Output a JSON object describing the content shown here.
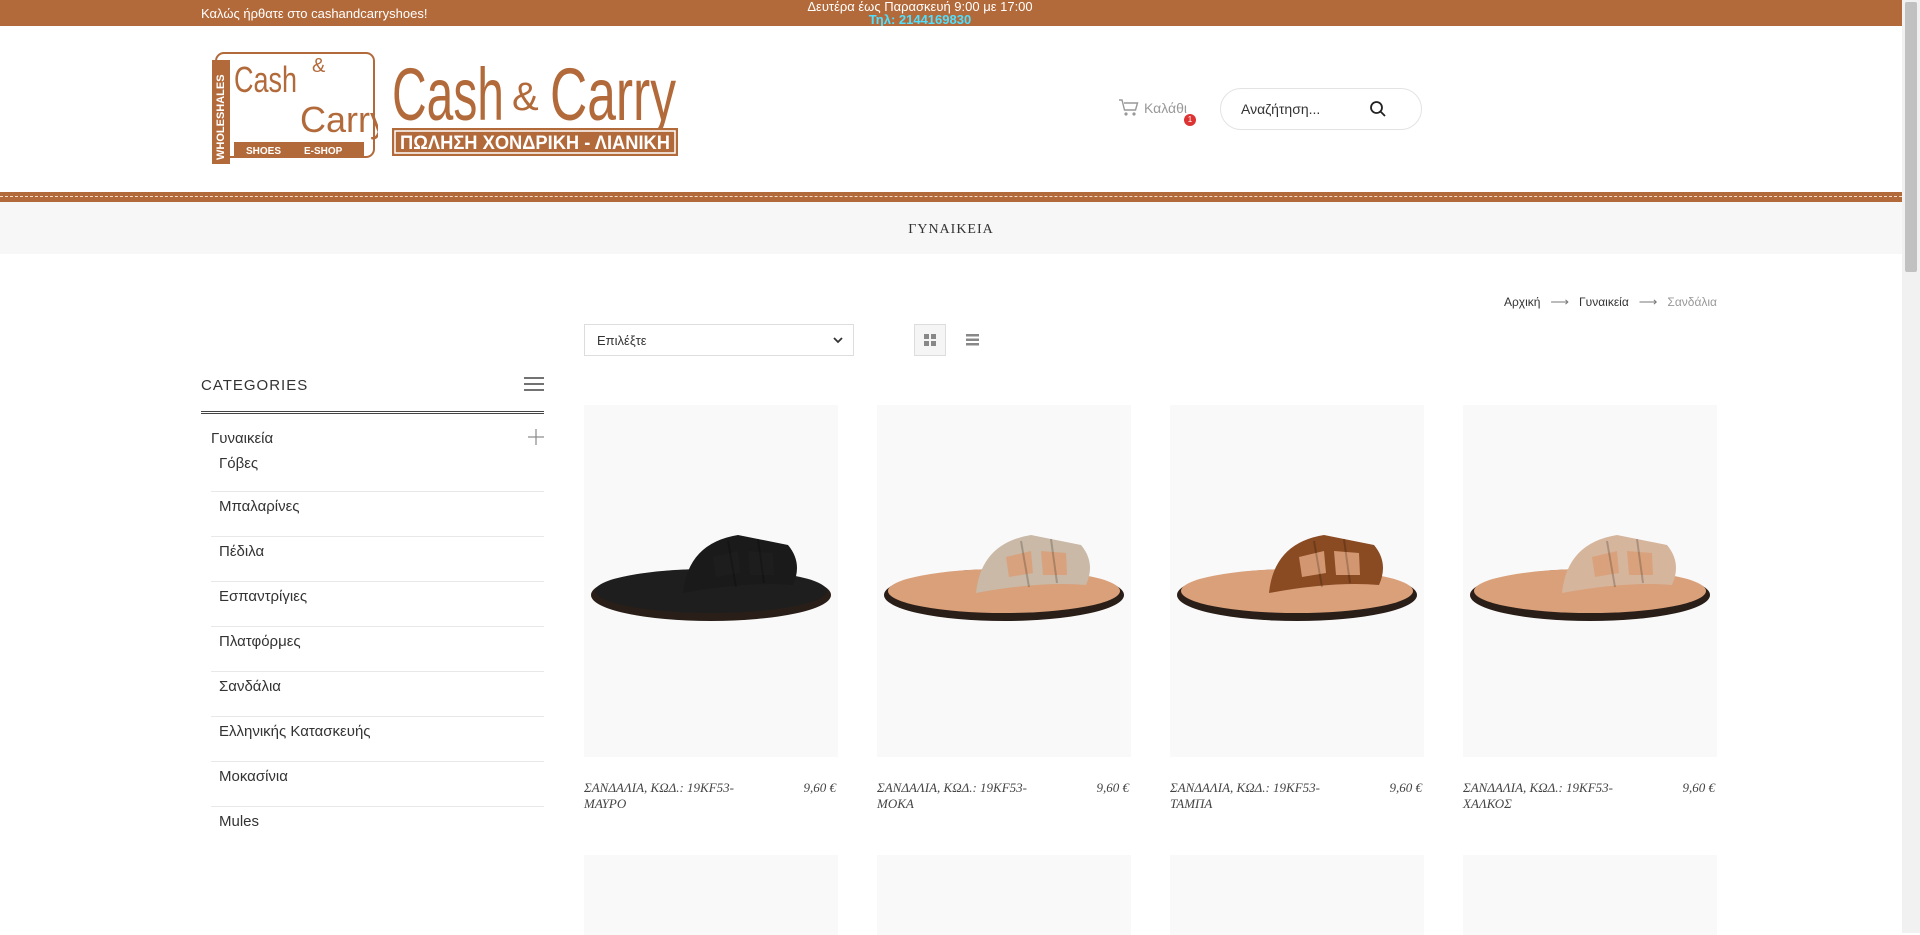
{
  "topbar": {
    "welcome": "Καλώς ήρθατε στο cashandcarryshoes!",
    "hours": "Δευτέρα έως Παρασκευή 9:00 με 17:00",
    "phone": "Τηλ: 2144169830"
  },
  "logo": {
    "badge_line1": "Cash",
    "badge_amp": "&",
    "badge_line2": "Carry",
    "badge_side": "WHOLESHALES",
    "badge_shoes": "SHOES",
    "badge_eshop": "E-SHOP",
    "title_cash": "Cash",
    "title_amp": "&",
    "title_carry": "Carry",
    "tagline": "ΠΩΛΗΣΗ ΧΟΝΔΡΙΚΗ - ΛΙΑΝΙΚΗ"
  },
  "header": {
    "cart_label": "Καλάθι",
    "cart_count": "1",
    "search_placeholder": "Αναζήτηση..."
  },
  "nav": {
    "item": "ΓΥΝΑΙΚΕΙΑ"
  },
  "breadcrumb": {
    "home": "Αρχική",
    "category": "Γυναικεία",
    "current": "Σανδάλια",
    "sep": "⟶"
  },
  "toolbar": {
    "sort_value": "Επιλέξτε"
  },
  "sidebar": {
    "title": "CATEGORIES",
    "parent": "Γυναικεία",
    "items": [
      "Γόβες",
      "Μπαλαρίνες",
      "Πέδιλα",
      "Εσπαντρίγιες",
      "Πλατφόρμες",
      "Σανδάλια",
      "Ελληνικής Κατασκευής",
      "Μοκασίνια",
      "Mules"
    ]
  },
  "colors": {
    "brand": "#b26a3a",
    "phone": "#4fe0ff",
    "badge": "#dd3333"
  },
  "products": [
    {
      "name": "ΣΑΝΔΑΛΙΑ, ΚΩΔ.: 19KF53-ΜΑΥΡΟ",
      "price": "9,60 €",
      "strap": "#1a1a1a",
      "sole": "#1e1e1e"
    },
    {
      "name": "ΣΑΝΔΑΛΙΑ, ΚΩΔ.: 19KF53-ΜΟΚΑ",
      "price": "9,60 €",
      "strap": "#c9b9a6",
      "sole": "#d9a07a"
    },
    {
      "name": "ΣΑΝΔΑΛΙΑ, ΚΩΔ.: 19KF53-ΤΑΜΠΑ",
      "price": "9,60 €",
      "strap": "#8a4a22",
      "sole": "#d9a07a"
    },
    {
      "name": "ΣΑΝΔΑΛΙΑ, ΚΩΔ.: 19KF53-ΧΑΛΚΟΣ",
      "price": "9,60 €",
      "strap": "#d6b59d",
      "sole": "#d9a07a"
    }
  ]
}
